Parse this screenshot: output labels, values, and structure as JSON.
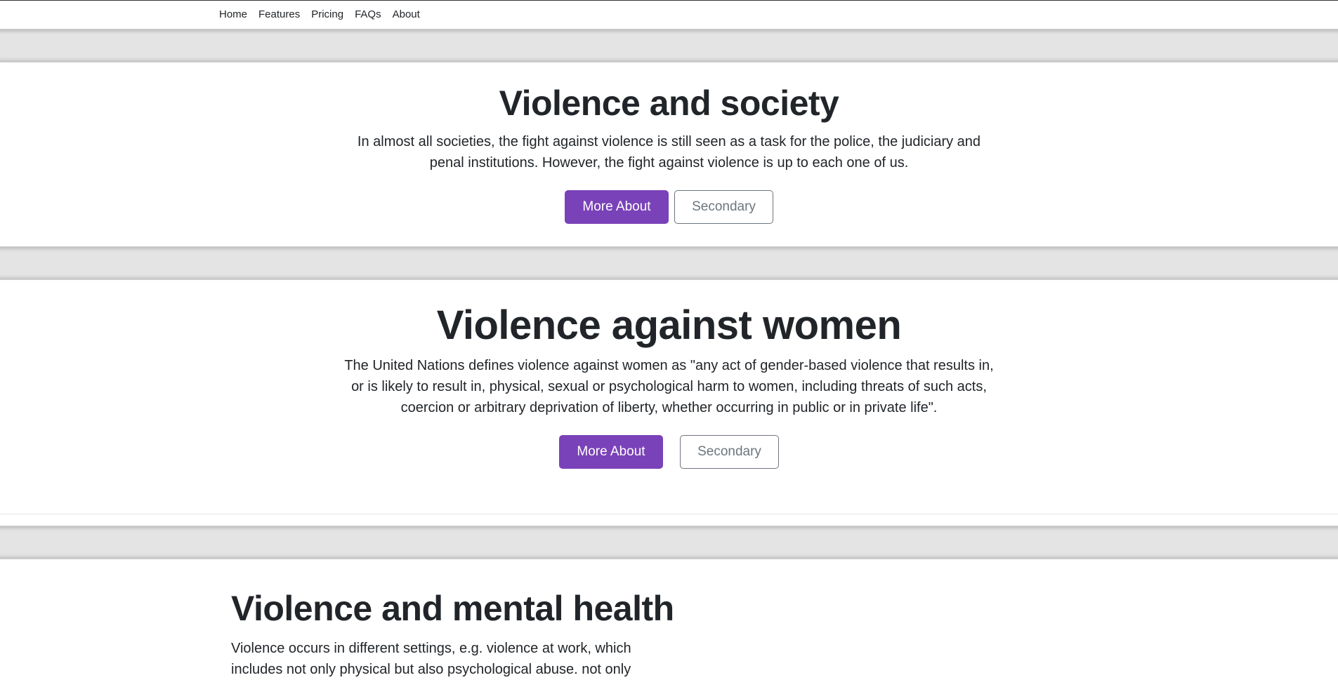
{
  "nav": {
    "items": [
      {
        "label": "Home"
      },
      {
        "label": "Features"
      },
      {
        "label": "Pricing"
      },
      {
        "label": "FAQs"
      },
      {
        "label": "About"
      }
    ]
  },
  "section1": {
    "title": "Violence and society",
    "text": "In almost all societies, the fight against violence is still seen as a task for the police, the judiciary and penal institutions. However, the fight against violence is up to each one of us.",
    "primary_label": "More About",
    "secondary_label": "Secondary"
  },
  "section2": {
    "title": "Violence against women",
    "text": "The United Nations defines violence against women as \"any act of gender-based violence that results in, or is likely to result in, physical, sexual or psychological harm to women, including threats of such acts, coercion or arbitrary deprivation of liberty, whether occurring in public or in private life\".",
    "primary_label": "More About",
    "secondary_label": "Secondary"
  },
  "section3": {
    "title": "Violence and mental health",
    "text": "Violence occurs in different settings, e.g. violence at work, which includes not only physical but also psychological abuse. not only"
  },
  "colors": {
    "primary": "#7a42b8",
    "secondary": "#6c757d",
    "band": "#e4e4e4",
    "text": "#212529"
  }
}
